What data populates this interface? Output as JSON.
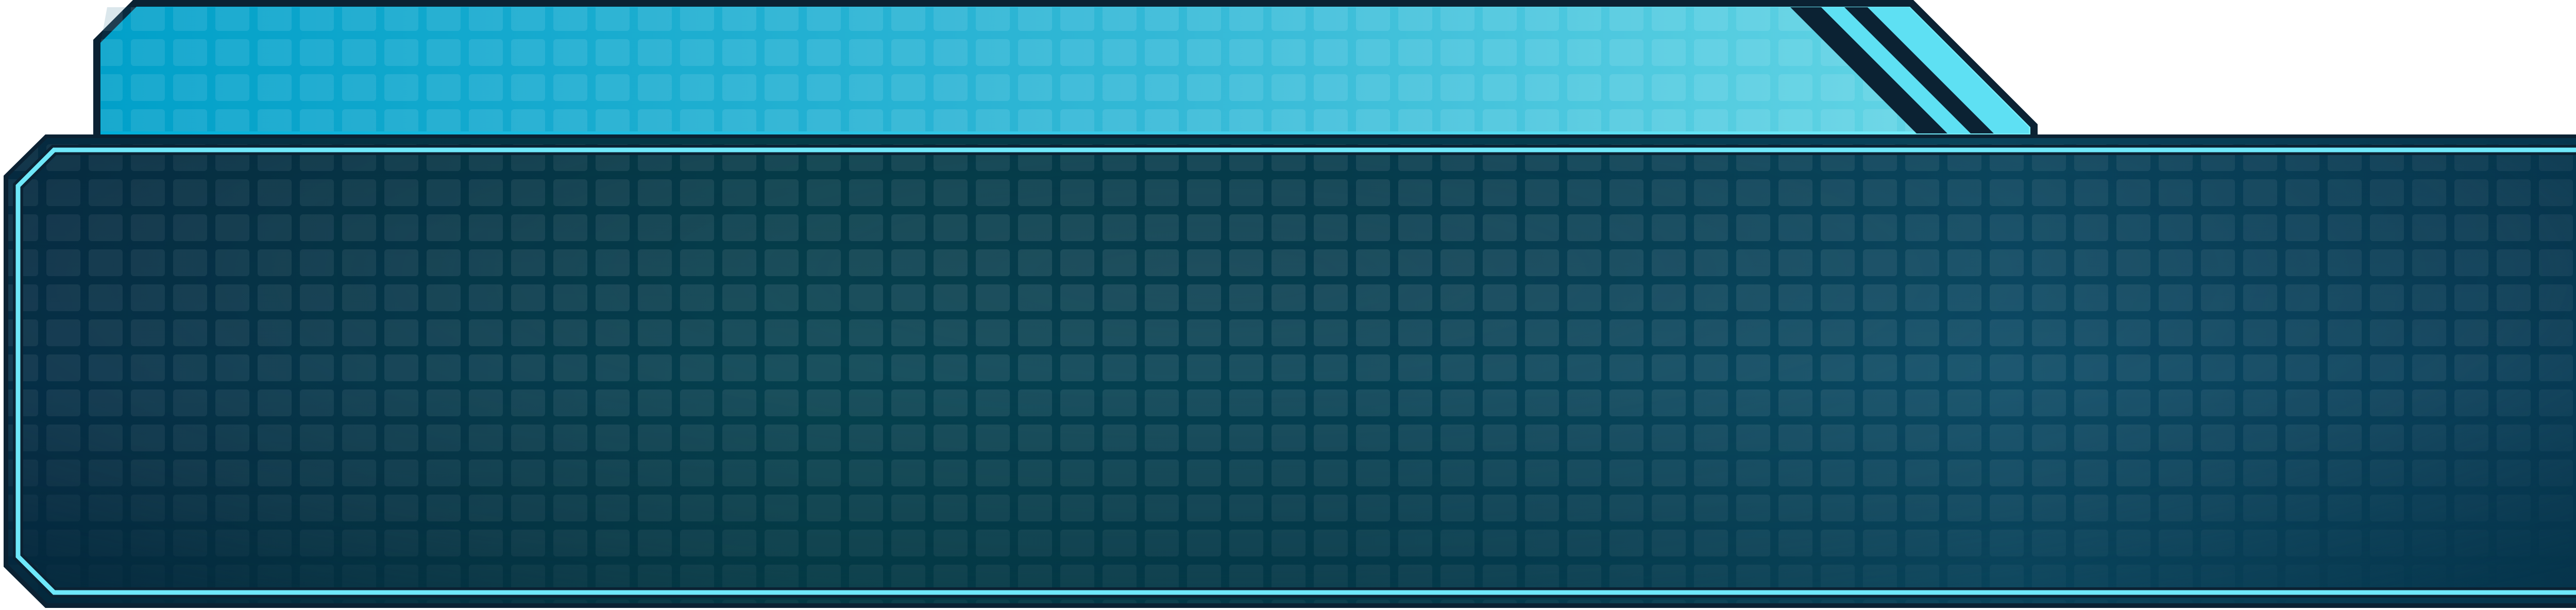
{
  "colors": {
    "outline": "#0b2233",
    "tab_gradient_start": "#00aed8",
    "tab_gradient_end": "#7af0fb",
    "stripe_fill": "#5ee0f3",
    "panel_dark": "#053049",
    "panel_teal": "#035162",
    "panel_right": "#0b4a67",
    "panel_border_glow": "#6fe8fa",
    "grid_dark_tile": "#0a2a3c"
  },
  "icons": {
    "tab_accent": "diagonal-stripes-icon",
    "panel_pattern": "tile-grid-pattern"
  }
}
